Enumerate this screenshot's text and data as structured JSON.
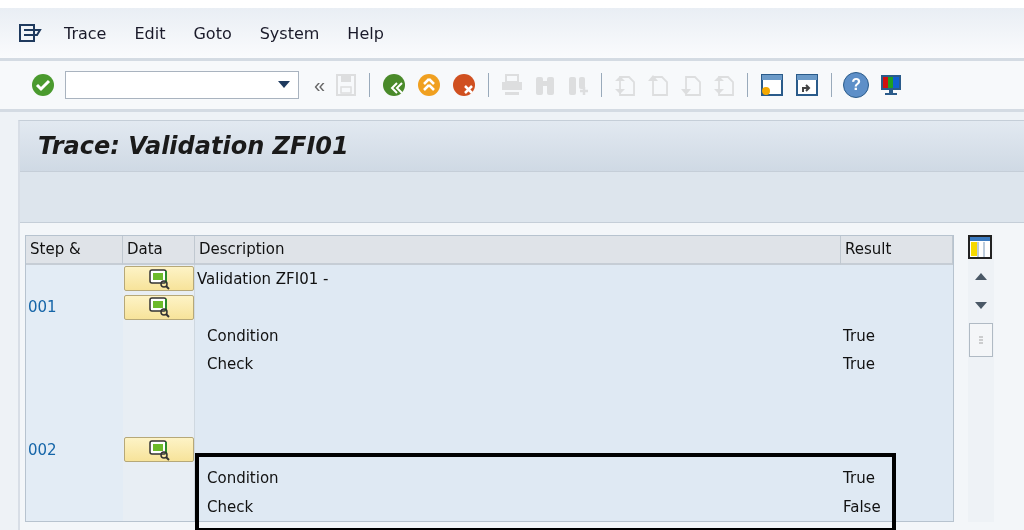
{
  "menu": [
    {
      "label": "Trace"
    },
    {
      "label": "Edit"
    },
    {
      "label": "Goto"
    },
    {
      "label": "System"
    },
    {
      "label": "Help"
    }
  ],
  "toolbar": [
    {
      "kind": "enter",
      "disabled": false
    },
    {
      "kind": "command-field"
    },
    {
      "kind": "back-chevrons",
      "glyph": "«",
      "disabled": false
    },
    {
      "kind": "save",
      "disabled": true
    },
    {
      "kind": "separator"
    },
    {
      "kind": "back",
      "disabled": false
    },
    {
      "kind": "exit",
      "disabled": false
    },
    {
      "kind": "cancel",
      "disabled": false
    },
    {
      "kind": "separator"
    },
    {
      "kind": "print",
      "disabled": true
    },
    {
      "kind": "find",
      "disabled": true
    },
    {
      "kind": "find-next",
      "disabled": true
    },
    {
      "kind": "separator"
    },
    {
      "kind": "first-page",
      "disabled": true
    },
    {
      "kind": "previous-page",
      "disabled": true
    },
    {
      "kind": "next-page",
      "disabled": true
    },
    {
      "kind": "last-page",
      "disabled": true
    },
    {
      "kind": "separator"
    },
    {
      "kind": "new-session",
      "disabled": false
    },
    {
      "kind": "shortcut",
      "disabled": false
    },
    {
      "kind": "separator"
    },
    {
      "kind": "help",
      "glyph": "?",
      "disabled": false
    },
    {
      "kind": "layout",
      "disabled": false
    }
  ],
  "title": "Trace: Validation ZFI01",
  "table": {
    "columns": [
      "Step &",
      "Data",
      "Description",
      "Result"
    ],
    "rows": [
      {
        "step": "",
        "has_data": true,
        "description": "Validation ZFI01 -",
        "kind": "heading",
        "result": "",
        "highlighted": false
      },
      {
        "step": "001",
        "has_data": true,
        "description": "",
        "kind": "heading",
        "result": "",
        "highlighted": false
      },
      {
        "step": "",
        "has_data": false,
        "description": "Condition",
        "kind": "entry",
        "result": "True",
        "highlighted": false
      },
      {
        "step": "",
        "has_data": false,
        "description": "Check",
        "kind": "entry",
        "result": "True",
        "highlighted": false
      },
      {
        "step": "",
        "has_data": false,
        "description": "",
        "kind": "entry",
        "result": "",
        "highlighted": false
      },
      {
        "step": "",
        "has_data": false,
        "description": "",
        "kind": "entry",
        "result": "",
        "highlighted": false
      },
      {
        "step": "002",
        "has_data": true,
        "description": "",
        "kind": "heading",
        "result": "",
        "highlighted": false
      },
      {
        "step": "",
        "has_data": false,
        "description": "Condition",
        "kind": "entry",
        "result": "True",
        "highlighted": true
      },
      {
        "step": "",
        "has_data": false,
        "description": "Check",
        "kind": "entry",
        "result": "False",
        "highlighted": true
      }
    ]
  }
}
